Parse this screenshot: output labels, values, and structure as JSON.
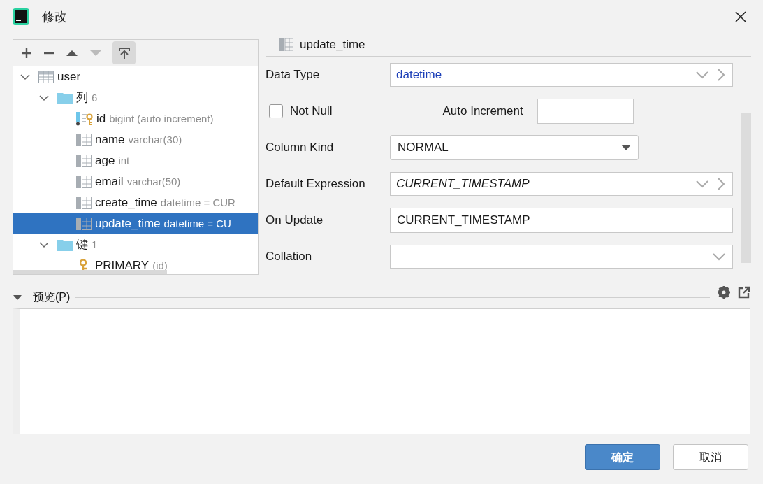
{
  "window": {
    "title": "修改"
  },
  "tree": [
    {
      "kind": "table",
      "name": "user",
      "expanded": true,
      "selected": false,
      "children": [
        {
          "kind": "folder",
          "name": "列",
          "detail": "6",
          "expanded": true,
          "selected": false,
          "children": [
            {
              "kind": "key-column",
              "name": "id",
              "detail": "bigint (auto increment)",
              "selected": false
            },
            {
              "kind": "column",
              "name": "name",
              "detail": "varchar(30)",
              "selected": false
            },
            {
              "kind": "column",
              "name": "age",
              "detail": "int",
              "selected": false
            },
            {
              "kind": "column",
              "name": "email",
              "detail": "varchar(50)",
              "selected": false
            },
            {
              "kind": "column",
              "name": "create_time",
              "detail": "datetime = CUR",
              "selected": false
            },
            {
              "kind": "column",
              "name": "update_time",
              "detail": "datetime = CU",
              "selected": true
            }
          ]
        },
        {
          "kind": "folder",
          "name": "键",
          "detail": "1",
          "expanded": true,
          "selected": false,
          "children": [
            {
              "kind": "key",
              "name": "PRIMARY",
              "detail": "(id)",
              "selected": false
            }
          ]
        }
      ]
    }
  ],
  "editor": {
    "title": "update_time",
    "fields": [
      {
        "kind": "type-combo",
        "label": "Data Type",
        "value": "datetime"
      },
      {
        "kind": "checkbox-row",
        "label": "Not Null",
        "checked": false,
        "extra_label": "Auto Increment"
      },
      {
        "kind": "dropdown",
        "label": "Column Kind",
        "value": "NORMAL"
      },
      {
        "kind": "expression-combo",
        "label": "Default Expression",
        "value": "CURRENT_TIMESTAMP"
      },
      {
        "kind": "text",
        "label": "On Update",
        "value": "CURRENT_TIMESTAMP"
      },
      {
        "kind": "combo",
        "label": "Collation"
      }
    ]
  },
  "preview": {
    "title": "预览(P)",
    "expanded": true
  },
  "buttons": [
    {
      "label": "确定",
      "primary": true
    },
    {
      "label": "取消",
      "primary": false
    }
  ]
}
